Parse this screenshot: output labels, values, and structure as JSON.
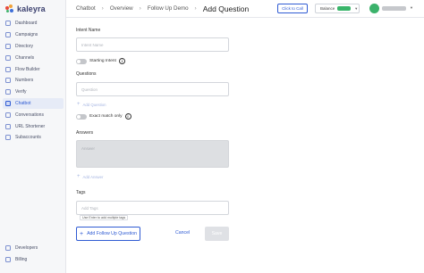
{
  "brand": {
    "name": "kaleyra"
  },
  "sidebar": {
    "items": [
      {
        "label": "Dashboard",
        "icon": "dashboard-icon"
      },
      {
        "label": "Campaigns",
        "icon": "campaigns-icon"
      },
      {
        "label": "Directory",
        "icon": "directory-icon"
      },
      {
        "label": "Channels",
        "icon": "channels-icon"
      },
      {
        "label": "Flow Builder",
        "icon": "flow-builder-icon"
      },
      {
        "label": "Numbers",
        "icon": "numbers-icon"
      },
      {
        "label": "Verify",
        "icon": "verify-icon"
      },
      {
        "label": "Chatbot",
        "icon": "chatbot-icon",
        "active": true
      },
      {
        "label": "Conversations",
        "icon": "conversations-icon"
      },
      {
        "label": "URL Shortener",
        "icon": "url-shortener-icon"
      },
      {
        "label": "Subaccounts",
        "icon": "subaccounts-icon"
      }
    ],
    "bottom_items": [
      {
        "label": "Developers",
        "icon": "developers-icon"
      },
      {
        "label": "Billing",
        "icon": "billing-icon"
      }
    ]
  },
  "header": {
    "breadcrumb": [
      "Chatbot",
      "Overview",
      "Follow Up Demo"
    ],
    "current": "Add Question",
    "click_to_call": "Click to Call",
    "balance_label": "Balance",
    "balance_color": "#39b56a",
    "avatar_color": "#3bb26b"
  },
  "form": {
    "intent_label": "Intent Name",
    "intent_placeholder": "Intent Name",
    "starting_intent_label": "Starting Intent",
    "questions_label": "Questions",
    "question_placeholder": "Question",
    "add_question": "Add Question",
    "exact_match_label": "Exact match only",
    "answers_label": "Answers",
    "answer_placeholder": "Answer",
    "add_answer": "Add Answer",
    "tags_label": "Tags",
    "tags_placeholder": "Add Tags",
    "tags_hint": "Use Enter to add multiple tags",
    "info_glyph": "i"
  },
  "actions": {
    "add_follow_up": "Add Follow Up Question",
    "cancel": "Cancel",
    "save": "Save"
  },
  "colors": {
    "accent": "#2f5bd3"
  }
}
